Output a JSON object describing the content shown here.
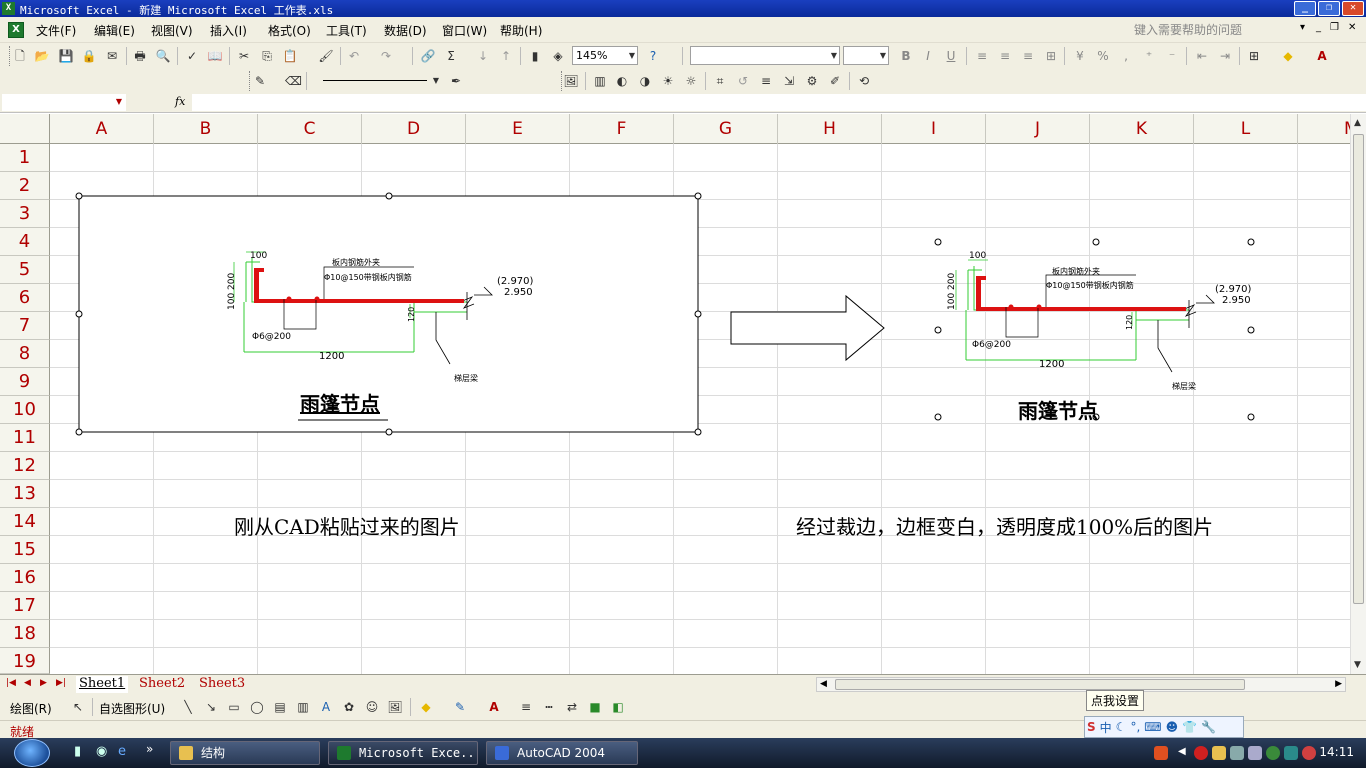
{
  "window": {
    "title": "Microsoft Excel - 新建 Microsoft Excel 工作表.xls",
    "app_icon": "excel-icon"
  },
  "menu": {
    "items": [
      "文件(F)",
      "编辑(E)",
      "视图(V)",
      "插入(I)",
      "格式(O)",
      "工具(T)",
      "数据(D)",
      "窗口(W)",
      "帮助(H)"
    ],
    "help_placeholder": "键入需要帮助的问题"
  },
  "toolbar": {
    "zoom": "145%"
  },
  "columns": [
    "A",
    "B",
    "C",
    "D",
    "E",
    "F",
    "G",
    "H",
    "I",
    "J",
    "K",
    "L",
    "M"
  ],
  "rows": [
    "1",
    "2",
    "3",
    "4",
    "5",
    "6",
    "7",
    "8",
    "9",
    "10",
    "11",
    "12",
    "13",
    "14",
    "15",
    "16",
    "17",
    "18",
    "19"
  ],
  "drawing_left": {
    "labels": {
      "dim_100": "100",
      "dim_100_200": "100 200",
      "note_top": "板内钢筋外夹",
      "note_bar": "Φ10@150带钢板内钢筋",
      "elev_top": "(2.970)",
      "elev_bottom": "2.950",
      "dim_120": "120",
      "rebar": "Φ6@200",
      "dim_1200": "1200",
      "beam": "梯层梁",
      "title": "雨篷节点"
    }
  },
  "drawing_right": {
    "labels": {
      "dim_100": "100",
      "dim_100_200": "100 200",
      "note_top": "板内钢筋外夹",
      "note_bar": "Φ10@150带钢板内钢筋",
      "elev_top": "(2.970)",
      "elev_bottom": "2.950",
      "dim_120": "120",
      "rebar": "Φ6@200",
      "dim_1200": "1200",
      "beam": "梯层梁",
      "title": "雨篷节点"
    }
  },
  "captions": {
    "left": "刚从CAD粘贴过来的图片",
    "right": "经过裁边，边框变白，透明度成100%后的图片"
  },
  "sheets": [
    "Sheet1",
    "Sheet2",
    "Sheet3"
  ],
  "active_sheet": "Sheet1",
  "drawbar": {
    "draw_menu": "绘图(R)",
    "autoshapes_menu": "自选图形(U)"
  },
  "status": "就绪",
  "ime": {
    "tooltip": "点我设置",
    "mode": "中"
  },
  "taskbar": {
    "items": [
      "结构",
      "Microsoft Exce...",
      "AutoCAD 2004"
    ],
    "clock": "14:11"
  }
}
